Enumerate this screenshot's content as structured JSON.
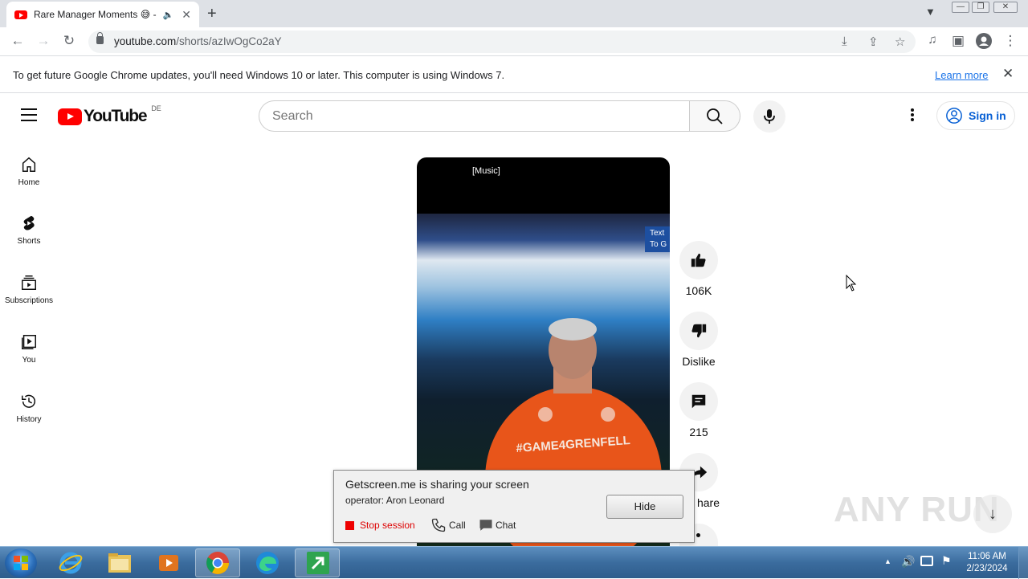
{
  "browser": {
    "tab_title": "Rare Manager Moments 😅 -",
    "tab_close": "✕",
    "new_tab": "+",
    "url_domain": "youtube.com",
    "url_path": "/shorts/azIwOgCo2aY",
    "window_buttons": [
      "—",
      "❐",
      "✕"
    ]
  },
  "infobar": {
    "message": "To get future Google Chrome updates, you'll need Windows 10 or later. This computer is using Windows 7.",
    "learn_more": "Learn more",
    "close": "✕"
  },
  "youtube": {
    "country_code": "DE",
    "logo_text": "YouTube",
    "search_placeholder": "Search",
    "sign_in": "Sign in",
    "sidebar": [
      {
        "label": "Home",
        "icon": "home-icon"
      },
      {
        "label": "Shorts",
        "icon": "shorts-icon"
      },
      {
        "label": "Subscriptions",
        "icon": "subscriptions-icon"
      },
      {
        "label": "You",
        "icon": "you-icon"
      },
      {
        "label": "History",
        "icon": "history-icon"
      }
    ]
  },
  "short": {
    "caption": "[Music]",
    "overlay_text": "Text To G",
    "jersey_text": "#GAME4GRENFELL",
    "actions": {
      "like_count": "106K",
      "dislike_label": "Dislike",
      "comment_count": "215",
      "share_label": "hare"
    }
  },
  "getscreen_popup": {
    "title": "Getscreen.me is sharing your screen",
    "operator": "operator: Aron Leonard",
    "hide_button": "Hide",
    "stop_session": "Stop session",
    "call": "Call",
    "chat": "Chat"
  },
  "watermark": "ANY RUN",
  "taskbar": {
    "time": "11:06 AM",
    "date": "2/23/2024"
  }
}
